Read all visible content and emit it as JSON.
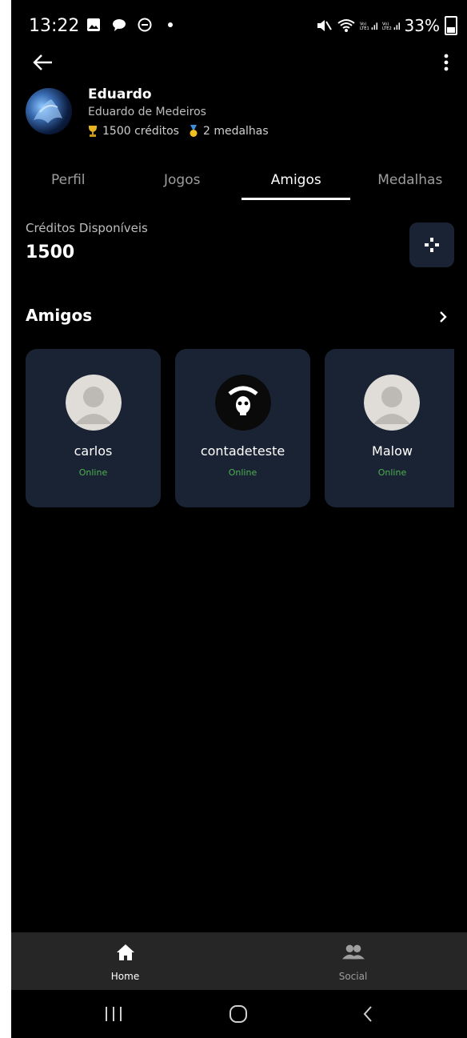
{
  "status_bar": {
    "time": "13:22",
    "battery": "33%",
    "icons": [
      "image-icon",
      "chat-icon",
      "dnd-icon",
      "dot-icon",
      "mute-icon",
      "wifi-icon",
      "signal-icon-1",
      "signal-icon-2"
    ]
  },
  "profile": {
    "name": "Eduardo",
    "full_name": "Eduardo de Medeiros",
    "credits_stat": "1500 créditos",
    "medals_stat": "2 medalhas"
  },
  "tabs": [
    {
      "label": "Perfil",
      "active": false
    },
    {
      "label": "Jogos",
      "active": false
    },
    {
      "label": "Amigos",
      "active": true
    },
    {
      "label": "Medalhas",
      "active": false
    }
  ],
  "credits": {
    "label": "Créditos Disponíveis",
    "value": "1500"
  },
  "friends_section": {
    "title": "Amigos",
    "friends": [
      {
        "name": "carlos",
        "status": "Online",
        "avatar": "default-avatar"
      },
      {
        "name": "contadeteste",
        "status": "Online",
        "avatar": "skull-avatar"
      },
      {
        "name": "Malow",
        "status": "Online",
        "avatar": "default-avatar"
      }
    ]
  },
  "bottom_nav": {
    "items": [
      {
        "label": "Home",
        "icon": "home-icon",
        "active": true
      },
      {
        "label": "Social",
        "icon": "people-icon",
        "active": false
      }
    ]
  },
  "colors": {
    "background": "#000000",
    "card": "#1a2333",
    "online": "#4caf50",
    "nav_bar": "#262626"
  }
}
